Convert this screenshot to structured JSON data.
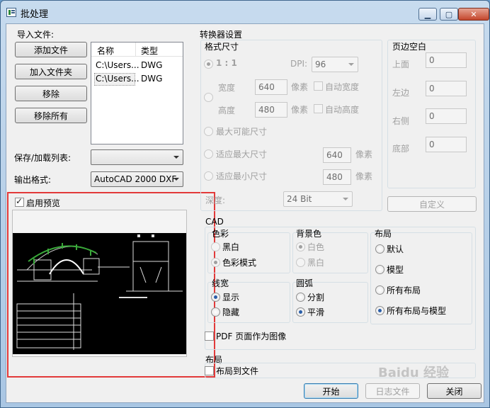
{
  "window": {
    "title": "批处理"
  },
  "colors": {
    "accent": "#3c7fb1",
    "highlight_box": "#e23a3a",
    "disabled_text": "#a0a0a0"
  },
  "import": {
    "group_label": "导入文件:",
    "buttons": {
      "add_file": "添加文件",
      "add_folder": "加入文件夹",
      "remove": "移除",
      "remove_all": "移除所有"
    },
    "columns": {
      "name": "名称",
      "type": "类型"
    },
    "files": [
      {
        "name": "C:\\Users...",
        "type": "DWG"
      },
      {
        "name": "C:\\Users...",
        "type": "DWG"
      }
    ]
  },
  "save_load": {
    "label": "保存/加载列表:",
    "value": ""
  },
  "output": {
    "label": "输出格式:",
    "value": "AutoCAD 2000 DXF"
  },
  "preview": {
    "enable_label": "启用预览",
    "enabled": true
  },
  "converter": {
    "group_label": "转换器设置",
    "format_size": {
      "label": "格式尺寸",
      "ratio": "1 : 1",
      "dpi_label": "DPI:",
      "dpi_value": "96",
      "width_label": "宽度",
      "width_value": "640",
      "height_label": "高度",
      "height_value": "480",
      "pixel_unit": "像素",
      "auto_width": "自动宽度",
      "auto_height": "自动高度",
      "max_possible": "最大可能尺寸",
      "fit_max": "适应最大尺寸",
      "fit_max_value": "640",
      "fit_min": "适应最小尺寸",
      "fit_min_value": "480",
      "depth_label": "深度:",
      "depth_value": "24 Bit"
    },
    "margins": {
      "label": "页边空白",
      "top_label": "上面",
      "top_value": "0",
      "left_label": "左边",
      "left_value": "0",
      "right_label": "右侧",
      "right_value": "0",
      "bottom_label": "底部",
      "bottom_value": "0",
      "custom_button": "自定义"
    }
  },
  "cad": {
    "group_label": "CAD",
    "color": {
      "label": "色彩",
      "bw": "黑白",
      "color_mode": "色彩模式"
    },
    "background": {
      "label": "背景色",
      "white": "白色",
      "black": "黑白"
    },
    "layout": {
      "label": "布局",
      "default": "默认",
      "model": "模型",
      "all_layouts": "所有布局",
      "all_layouts_model": "所有布局与模型"
    },
    "line_width": {
      "label": "线宽",
      "show": "显示",
      "hide": "隐藏"
    },
    "arc": {
      "label": "圆弧",
      "split": "分割",
      "smooth": "平滑"
    },
    "pdf_as_image": "PDF 页面作为图像"
  },
  "layout_section": {
    "label": "布局",
    "to_file": "布局到文件"
  },
  "footer": {
    "start": "开始",
    "log_file": "日志文件",
    "close": "关闭"
  },
  "watermark": "Baidu 经验"
}
